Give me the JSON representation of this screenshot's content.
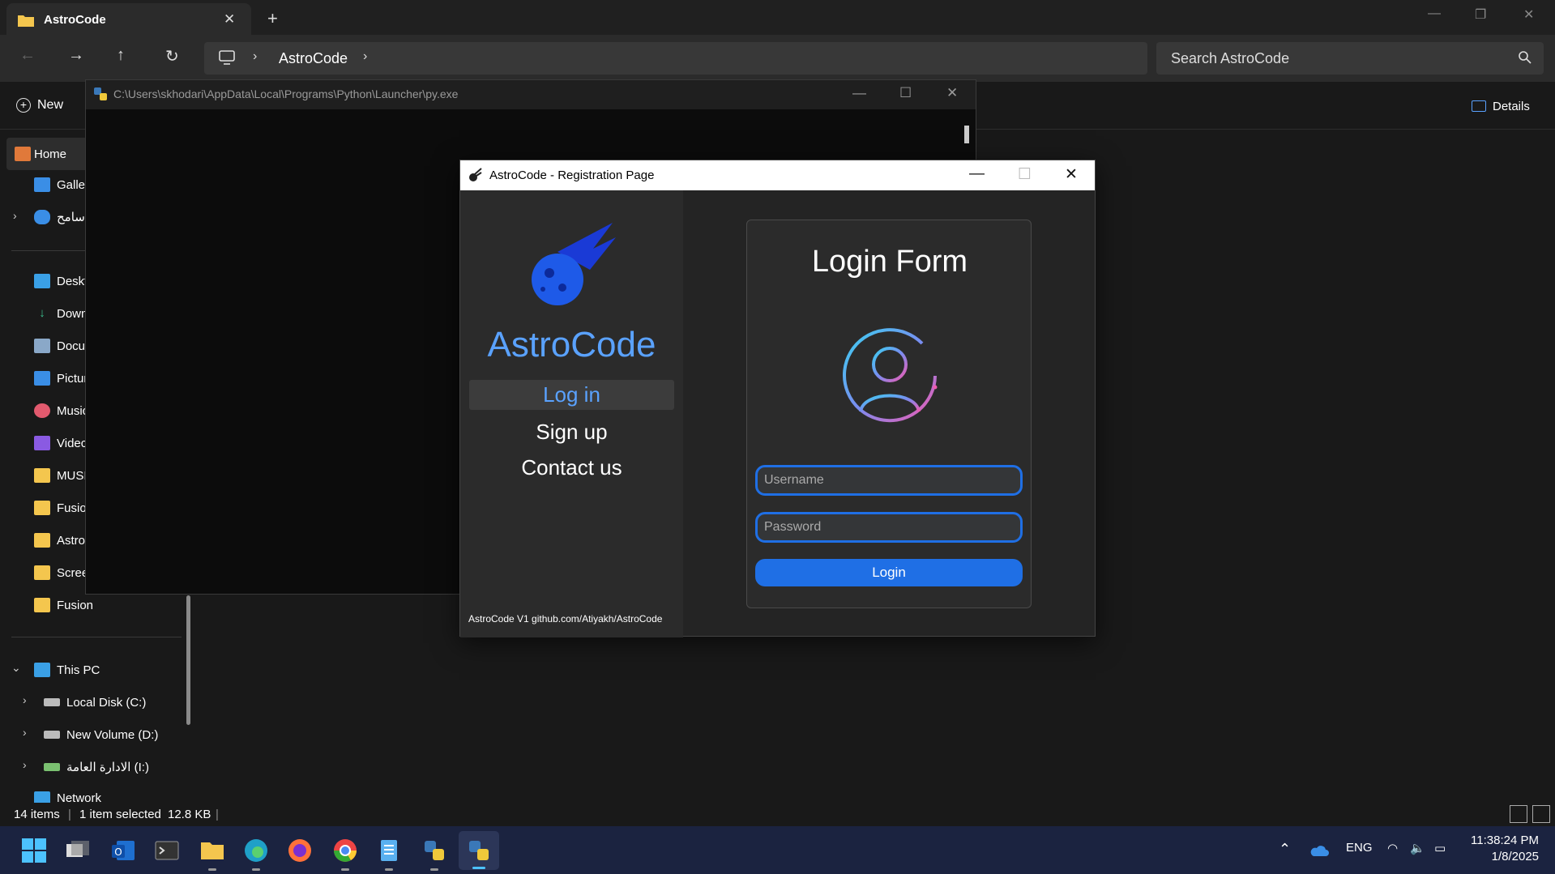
{
  "explorer": {
    "tab_title": "AstroCode",
    "address_crumb": "AstroCode",
    "search_placeholder": "Search AstroCode",
    "new_label": "New",
    "details_label": "Details",
    "sidebar": {
      "items": [
        "Home",
        "Galler",
        "سامح",
        "Deskt",
        "Down",
        "Docu",
        "Pictur",
        "Music",
        "Videc",
        "MUSI",
        "Fusio",
        "Astro",
        "Scree",
        "Fusion"
      ],
      "this_pc": "This PC",
      "drives": [
        "Local Disk (C:)",
        "New Volume (D:)",
        "الادارة العامة (I:)"
      ],
      "network": "Network"
    },
    "status": {
      "items": "14 items",
      "selected": "1 item selected",
      "size": "12.8 KB"
    }
  },
  "console": {
    "path": "C:\\Users\\skhodari\\AppData\\Local\\Programs\\Python\\Launcher\\py.exe"
  },
  "astro": {
    "window_title": "AstroCode - Registration Page",
    "brand": "AstroCode",
    "menu": [
      "Log in",
      "Sign up",
      "Contact us"
    ],
    "footer": "AstroCode V1 github.com/Atiyakh/AstroCode",
    "form_title": "Login Form",
    "username_placeholder": "Username",
    "password_placeholder": "Password",
    "login_label": "Login"
  },
  "taskbar": {
    "lang": "ENG",
    "time": "11:38:24 PM",
    "date": "1/8/2025"
  },
  "colors": {
    "accent": "#1f6fe5",
    "brand": "#5aa2ff",
    "taskbar": "#1b2340"
  }
}
